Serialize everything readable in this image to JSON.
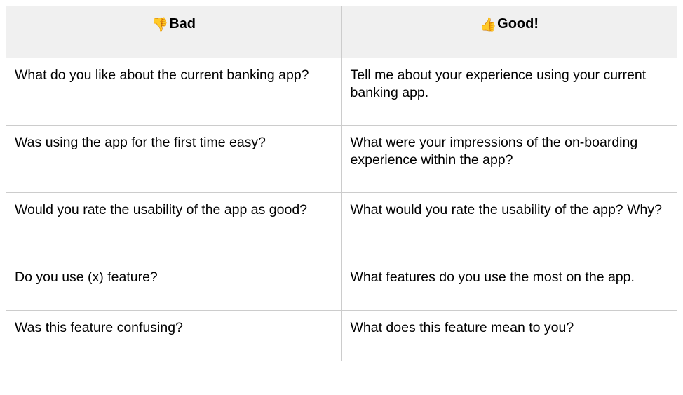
{
  "table": {
    "headers": {
      "bad_emoji": "👎",
      "bad_label": "Bad",
      "good_emoji": "👍",
      "good_label": "Good!"
    },
    "rows": [
      {
        "bad": "What do you like about the current banking app?",
        "good": "Tell me about your experience using your current banking app."
      },
      {
        "bad": "Was using the app for the first time easy?",
        "good": "What were your impressions of the on-boarding experience within the app?"
      },
      {
        "bad": "Would you rate the usability of the app as good?",
        "good": "What would you rate the usability of the app? Why?"
      },
      {
        "bad": "Do you use (x) feature?",
        "good": "What features do you use the most on the app."
      },
      {
        "bad": "Was this feature confusing?",
        "good": "What does this feature mean to you?"
      }
    ]
  }
}
